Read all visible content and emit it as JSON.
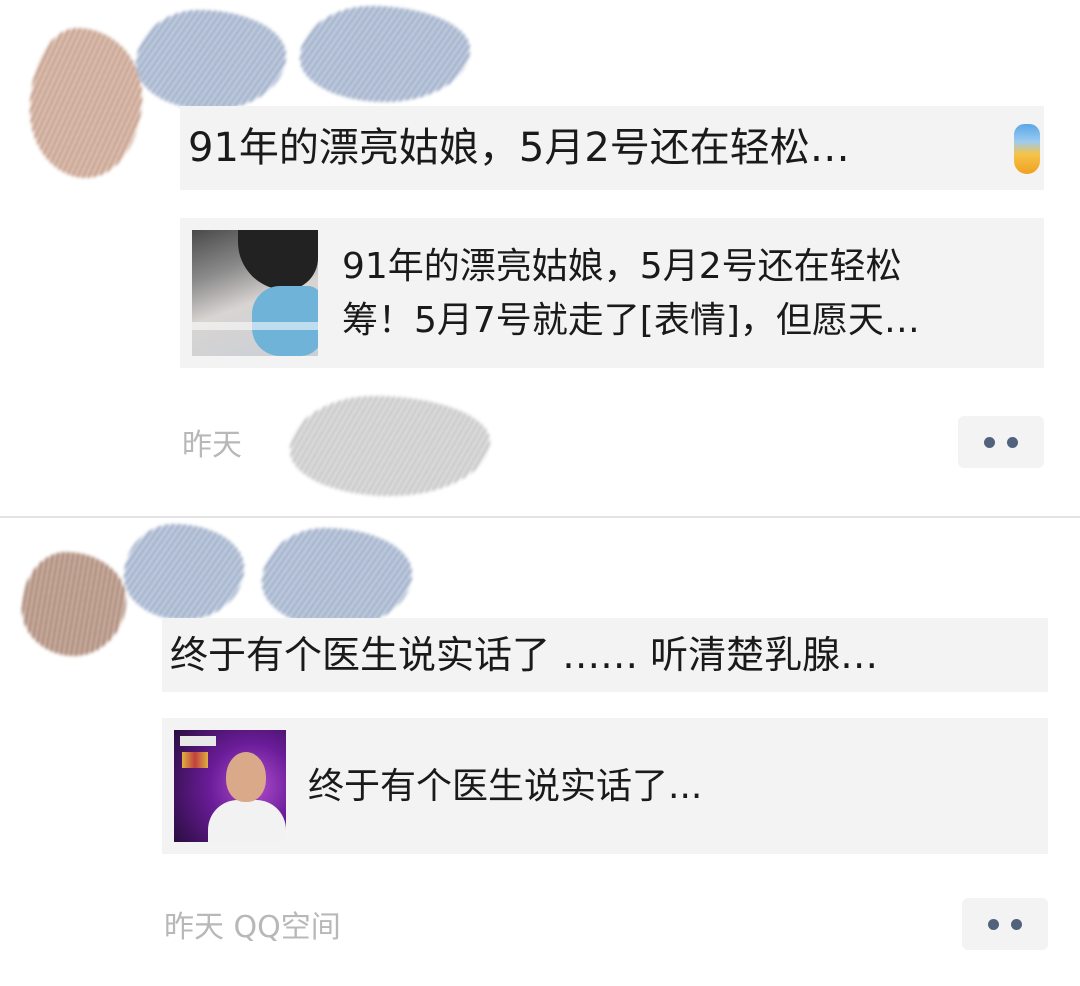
{
  "posts": [
    {
      "share_title": "91年的漂亮姑娘，5月2号还在轻松…",
      "emoji_icon": "scream-emoji-icon",
      "link_card": {
        "line1": "91年的漂亮姑娘，5月2号还在轻松",
        "line2": "筹！5月7号就走了[表情]，但愿天…"
      },
      "meta": "昨天"
    },
    {
      "share_title": "终于有个医生说实话了 …… 听清楚乳腺…",
      "link_card": {
        "line1": "终于有个医生说实话了..."
      },
      "meta": "昨天 QQ空间"
    }
  ],
  "colors": {
    "card_bg": "#f3f3f3",
    "more_dots": "#52627d",
    "meta_text": "#b8b8b8"
  }
}
